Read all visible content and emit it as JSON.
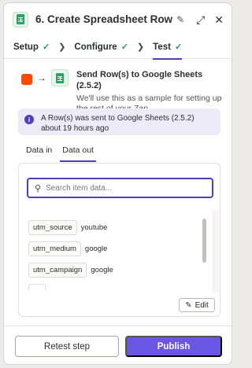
{
  "header": {
    "app_icon": "google-sheets-icon",
    "title": "6. Create Spreadsheet Row",
    "edit_icon": "pencil-icon",
    "expand_icon": "expand-icon",
    "close_icon": "close-icon"
  },
  "steps_tabs": [
    {
      "label": "Setup",
      "done": true
    },
    {
      "label": "Configure",
      "done": true
    },
    {
      "label": "Test",
      "done": true,
      "active": true
    }
  ],
  "step": {
    "title": "Send Row(s) to Google Sheets (2.5.2)",
    "subtitle": "We'll use this as a sample for setting up the rest of your Zap."
  },
  "info": {
    "text": "A Row(s) was sent to Google Sheets (2.5.2) about 19 hours ago"
  },
  "data_tabs": {
    "in": "Data in",
    "out": "Data out"
  },
  "search": {
    "placeholder": "Search item data..."
  },
  "items": [
    {
      "key": "utm_source",
      "value": "youtube"
    },
    {
      "key": "utm_medium",
      "value": "google"
    },
    {
      "key": "utm_campaign",
      "value": "google"
    }
  ],
  "edit_label": "Edit",
  "footer": {
    "retest": "Retest step",
    "publish": "Publish"
  },
  "colors": {
    "accent": "#503ebb",
    "publish": "#6a56e3",
    "trigger": "#ff4a00",
    "check": "#2a9a4a"
  }
}
